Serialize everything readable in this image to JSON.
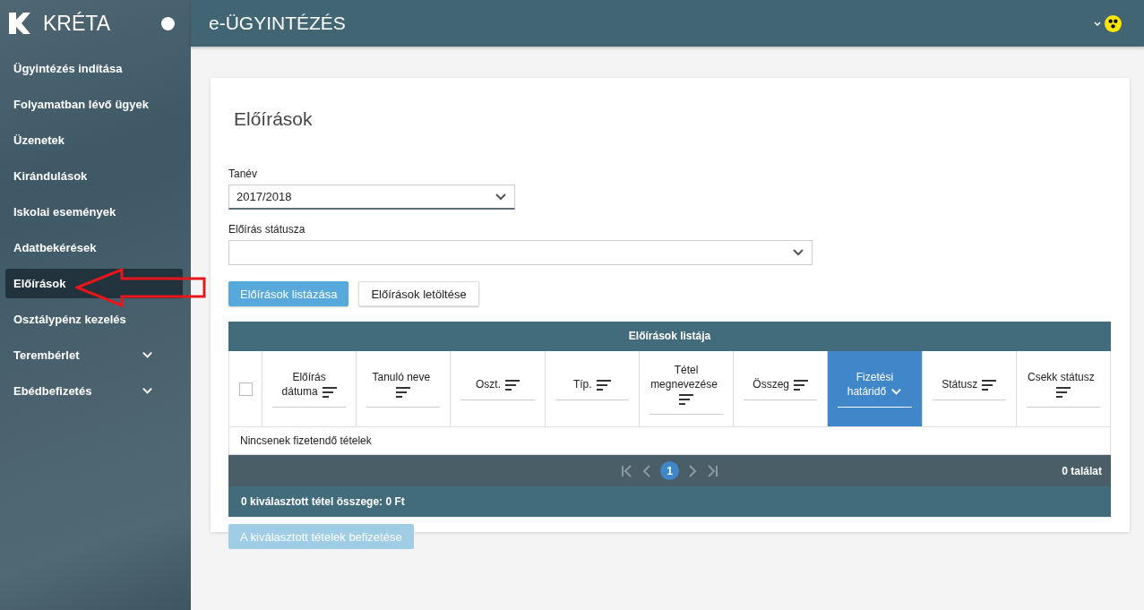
{
  "sidebar": {
    "brand": "KRÉTA",
    "items": [
      {
        "label": "Ügyintézés indítása",
        "kind": "link",
        "selected": false
      },
      {
        "label": "Folyamatban lévő ügyek",
        "kind": "link",
        "selected": false
      },
      {
        "label": "Üzenetek",
        "kind": "link",
        "selected": false
      },
      {
        "label": "Kirándulások",
        "kind": "link",
        "selected": false
      },
      {
        "label": "Iskolai események",
        "kind": "link",
        "selected": false
      },
      {
        "label": "Adatbekérések",
        "kind": "link",
        "selected": false
      },
      {
        "label": "Előírások",
        "kind": "link",
        "selected": true
      },
      {
        "label": "Osztálypénz kezelés",
        "kind": "link",
        "selected": false
      },
      {
        "label": "Terembérlet",
        "kind": "group",
        "selected": false
      },
      {
        "label": "Ebédbefizetés",
        "kind": "group",
        "selected": false
      }
    ]
  },
  "header": {
    "title": "e-ÜGYINTÉZÉS"
  },
  "page": {
    "title": "Előírások",
    "fields": [
      {
        "label": "Tanév",
        "value": "2017/2018",
        "kind": "short"
      },
      {
        "label": "Előírás státusza",
        "kind": "long"
      }
    ],
    "buttons": [
      {
        "label": "Előírások listázása",
        "kind": "primary"
      },
      {
        "label": "Előírások letöltése",
        "kind": "secondary"
      }
    ],
    "table": {
      "title": "Előírások listája",
      "select_all": {
        "checked": false
      },
      "columns": [
        {
          "label": "Előírás dátuma",
          "selected": false
        },
        {
          "label": "Tanuló neve",
          "selected": false
        },
        {
          "label": "Oszt.",
          "selected": false
        },
        {
          "label": "Típ.",
          "selected": false
        },
        {
          "label": "Tétel megnevezése",
          "selected": false
        },
        {
          "label": "Összeg",
          "selected": false
        },
        {
          "label": "Fizetési határidő",
          "selected": true
        },
        {
          "label": "Státusz",
          "selected": false
        },
        {
          "label": "Csekk státusz",
          "selected": false
        }
      ],
      "empty_message": "Nincsenek fizetendő tételek",
      "pager": {
        "pages": [
          {
            "label": "1",
            "selected": true
          }
        ],
        "count": "0 találat"
      },
      "summary": "0 kiválasztott tétel összege: 0 Ft"
    },
    "pay_button": {
      "label": "A kiválasztott tételek befizetése",
      "disabled": true
    }
  }
}
